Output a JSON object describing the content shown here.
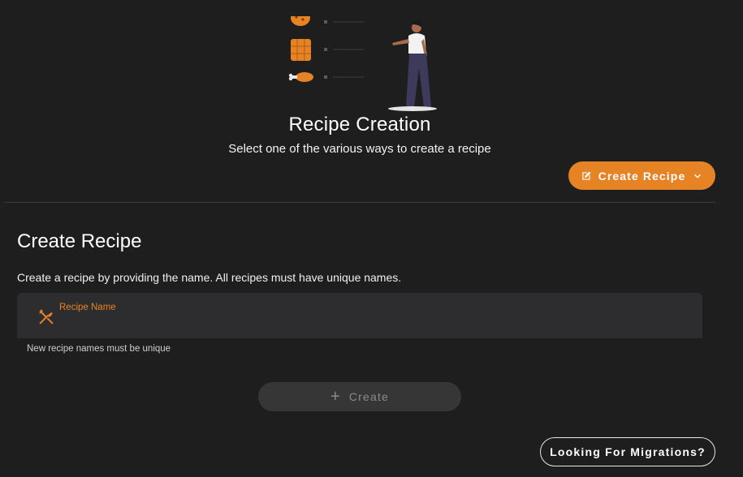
{
  "header": {
    "title": "Recipe Creation",
    "subtitle": "Select one of the various ways to create a recipe",
    "create_recipe_label": "Create Recipe"
  },
  "section": {
    "title": "Create Recipe",
    "description": "Create a recipe by providing the name. All recipes must have unique names."
  },
  "form": {
    "field_label": "Recipe Name",
    "field_value": "",
    "hint": "New recipe names must be unique",
    "create_label": "Create"
  },
  "footer": {
    "migrations_label": "Looking For Migrations?"
  },
  "colors": {
    "accent": "#e58325",
    "background": "#1e1e1f",
    "field_bg": "#2d2d2f"
  },
  "icons": {
    "create_recipe": "edit-square-icon",
    "dropdown": "chevron-down-icon",
    "field": "fork-knife-icon",
    "create": "plus-icon"
  }
}
